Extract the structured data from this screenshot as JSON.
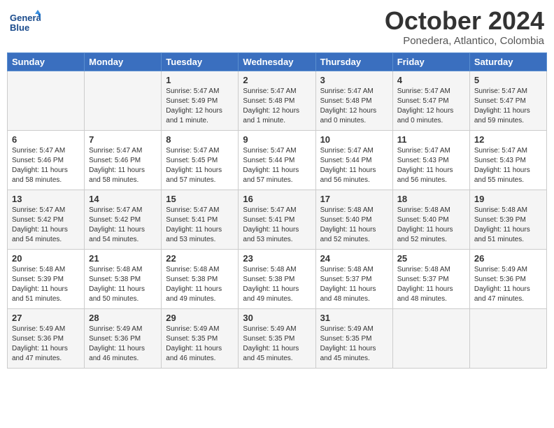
{
  "header": {
    "logo_text_general": "General",
    "logo_text_blue": "Blue",
    "month_title": "October 2024",
    "subtitle": "Ponedera, Atlantico, Colombia"
  },
  "days_of_week": [
    "Sunday",
    "Monday",
    "Tuesday",
    "Wednesday",
    "Thursday",
    "Friday",
    "Saturday"
  ],
  "weeks": [
    [
      {
        "day": "",
        "info": ""
      },
      {
        "day": "",
        "info": ""
      },
      {
        "day": "1",
        "info": "Sunrise: 5:47 AM\nSunset: 5:49 PM\nDaylight: 12 hours and 1 minute."
      },
      {
        "day": "2",
        "info": "Sunrise: 5:47 AM\nSunset: 5:48 PM\nDaylight: 12 hours and 1 minute."
      },
      {
        "day": "3",
        "info": "Sunrise: 5:47 AM\nSunset: 5:48 PM\nDaylight: 12 hours and 0 minutes."
      },
      {
        "day": "4",
        "info": "Sunrise: 5:47 AM\nSunset: 5:47 PM\nDaylight: 12 hours and 0 minutes."
      },
      {
        "day": "5",
        "info": "Sunrise: 5:47 AM\nSunset: 5:47 PM\nDaylight: 11 hours and 59 minutes."
      }
    ],
    [
      {
        "day": "6",
        "info": "Sunrise: 5:47 AM\nSunset: 5:46 PM\nDaylight: 11 hours and 58 minutes."
      },
      {
        "day": "7",
        "info": "Sunrise: 5:47 AM\nSunset: 5:46 PM\nDaylight: 11 hours and 58 minutes."
      },
      {
        "day": "8",
        "info": "Sunrise: 5:47 AM\nSunset: 5:45 PM\nDaylight: 11 hours and 57 minutes."
      },
      {
        "day": "9",
        "info": "Sunrise: 5:47 AM\nSunset: 5:44 PM\nDaylight: 11 hours and 57 minutes."
      },
      {
        "day": "10",
        "info": "Sunrise: 5:47 AM\nSunset: 5:44 PM\nDaylight: 11 hours and 56 minutes."
      },
      {
        "day": "11",
        "info": "Sunrise: 5:47 AM\nSunset: 5:43 PM\nDaylight: 11 hours and 56 minutes."
      },
      {
        "day": "12",
        "info": "Sunrise: 5:47 AM\nSunset: 5:43 PM\nDaylight: 11 hours and 55 minutes."
      }
    ],
    [
      {
        "day": "13",
        "info": "Sunrise: 5:47 AM\nSunset: 5:42 PM\nDaylight: 11 hours and 54 minutes."
      },
      {
        "day": "14",
        "info": "Sunrise: 5:47 AM\nSunset: 5:42 PM\nDaylight: 11 hours and 54 minutes."
      },
      {
        "day": "15",
        "info": "Sunrise: 5:47 AM\nSunset: 5:41 PM\nDaylight: 11 hours and 53 minutes."
      },
      {
        "day": "16",
        "info": "Sunrise: 5:47 AM\nSunset: 5:41 PM\nDaylight: 11 hours and 53 minutes."
      },
      {
        "day": "17",
        "info": "Sunrise: 5:48 AM\nSunset: 5:40 PM\nDaylight: 11 hours and 52 minutes."
      },
      {
        "day": "18",
        "info": "Sunrise: 5:48 AM\nSunset: 5:40 PM\nDaylight: 11 hours and 52 minutes."
      },
      {
        "day": "19",
        "info": "Sunrise: 5:48 AM\nSunset: 5:39 PM\nDaylight: 11 hours and 51 minutes."
      }
    ],
    [
      {
        "day": "20",
        "info": "Sunrise: 5:48 AM\nSunset: 5:39 PM\nDaylight: 11 hours and 51 minutes."
      },
      {
        "day": "21",
        "info": "Sunrise: 5:48 AM\nSunset: 5:38 PM\nDaylight: 11 hours and 50 minutes."
      },
      {
        "day": "22",
        "info": "Sunrise: 5:48 AM\nSunset: 5:38 PM\nDaylight: 11 hours and 49 minutes."
      },
      {
        "day": "23",
        "info": "Sunrise: 5:48 AM\nSunset: 5:38 PM\nDaylight: 11 hours and 49 minutes."
      },
      {
        "day": "24",
        "info": "Sunrise: 5:48 AM\nSunset: 5:37 PM\nDaylight: 11 hours and 48 minutes."
      },
      {
        "day": "25",
        "info": "Sunrise: 5:48 AM\nSunset: 5:37 PM\nDaylight: 11 hours and 48 minutes."
      },
      {
        "day": "26",
        "info": "Sunrise: 5:49 AM\nSunset: 5:36 PM\nDaylight: 11 hours and 47 minutes."
      }
    ],
    [
      {
        "day": "27",
        "info": "Sunrise: 5:49 AM\nSunset: 5:36 PM\nDaylight: 11 hours and 47 minutes."
      },
      {
        "day": "28",
        "info": "Sunrise: 5:49 AM\nSunset: 5:36 PM\nDaylight: 11 hours and 46 minutes."
      },
      {
        "day": "29",
        "info": "Sunrise: 5:49 AM\nSunset: 5:35 PM\nDaylight: 11 hours and 46 minutes."
      },
      {
        "day": "30",
        "info": "Sunrise: 5:49 AM\nSunset: 5:35 PM\nDaylight: 11 hours and 45 minutes."
      },
      {
        "day": "31",
        "info": "Sunrise: 5:49 AM\nSunset: 5:35 PM\nDaylight: 11 hours and 45 minutes."
      },
      {
        "day": "",
        "info": ""
      },
      {
        "day": "",
        "info": ""
      }
    ]
  ]
}
